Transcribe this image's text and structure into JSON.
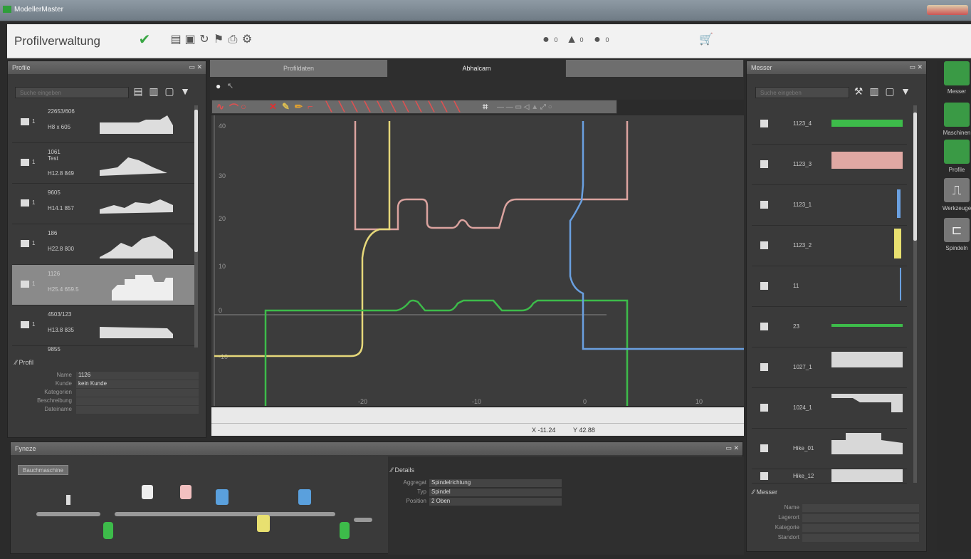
{
  "window": {
    "title": "ModellerMaster"
  },
  "toolbar": {
    "title": "Profilverwaltung",
    "icons": [
      "check-icon",
      "document-icon",
      "save-icon",
      "undo-icon",
      "flag-icon",
      "print-icon",
      "gear-icon"
    ],
    "status": [
      {
        "icon": "info-icon",
        "count": "0"
      },
      {
        "icon": "warning-icon",
        "count": "0"
      },
      {
        "icon": "error-icon",
        "count": "0"
      }
    ],
    "cart_icon": "cart-icon"
  },
  "profile_panel": {
    "title": "Profile",
    "search_placeholder": "Suche eingeben",
    "items": [
      {
        "num": "1",
        "line1": "22653/606",
        "line2": "H8 x 605",
        "selected": false
      },
      {
        "num": "1",
        "line1": "1061\nTest",
        "line2": "H12.8 849",
        "selected": false
      },
      {
        "num": "1",
        "line1": "9605",
        "line2": "H14.1 857",
        "selected": false
      },
      {
        "num": "1",
        "line1": "186",
        "line2": "H22.8 800",
        "selected": false
      },
      {
        "num": "1",
        "line1": "1126",
        "line2": "H25.4 659.5",
        "selected": true
      },
      {
        "num": "1",
        "line1": "4503/123",
        "line2": "H13.8 835",
        "selected": false
      }
    ],
    "partial_item": "9855",
    "props_title": "Profil",
    "props": [
      {
        "label": "Name",
        "value": "1126"
      },
      {
        "label": "Kunde",
        "value": "kein Kunde"
      },
      {
        "label": "Kategorien",
        "value": ""
      },
      {
        "label": "Beschreibung",
        "value": ""
      },
      {
        "label": "Dateiname",
        "value": ""
      }
    ]
  },
  "center": {
    "tabs": [
      "Profildaten",
      "Abhalcam",
      ""
    ],
    "active_tab": 1,
    "x_ticks": [
      "-20",
      "-10",
      "0",
      "10"
    ],
    "y_ticks": [
      "40",
      "30",
      "20",
      "10",
      "0",
      "-10"
    ],
    "coords": {
      "x": "X -11.24",
      "y": "Y 42.88"
    }
  },
  "messer_panel": {
    "title": "Messer",
    "search_placeholder": "Suche eingeben",
    "items": [
      {
        "name": "1123_4",
        "color": "#3dbb4a"
      },
      {
        "name": "1123_3",
        "color": "#e0a8a3"
      },
      {
        "name": "1123_1",
        "color": "#6aa0e0"
      },
      {
        "name": "1123_2",
        "color": "#e8e070"
      },
      {
        "name": "11",
        "color": "#6aa0e0"
      },
      {
        "name": "23",
        "color": "#3dbb4a"
      },
      {
        "name": "1027_1",
        "color": "#d8d8d8"
      },
      {
        "name": "1024_1",
        "color": "#d8d8d8"
      },
      {
        "name": "Hike_01",
        "color": "#d8d8d8"
      },
      {
        "name": "Hike_12",
        "color": "#d8d8d8"
      }
    ],
    "props_title": "Messer",
    "props": [
      "Name",
      "Lagerort",
      "Kategorie",
      "Standort"
    ]
  },
  "side_buttons": [
    {
      "label": "Messer",
      "icon": "knife-icon",
      "color": "#3a9a45"
    },
    {
      "label": "Maschinen",
      "icon": "machine-icon",
      "color": "#3a9a45"
    },
    {
      "label": "Profile",
      "icon": "profile-icon",
      "color": "#3a9a45"
    },
    {
      "label": "Werkzeuge",
      "icon": "tool-icon",
      "color": "#777777"
    },
    {
      "label": "Spindeln",
      "icon": "spindle-icon",
      "color": "#777777"
    }
  ],
  "bottom_panel": {
    "title": "Fyneze",
    "button": "Bauchmaschine",
    "details_title": "Details",
    "details": [
      {
        "label": "Aggregat",
        "value": "Spindelrichtung"
      },
      {
        "label": "Typ",
        "value": "Spindel"
      },
      {
        "label": "Position",
        "value": "2 Oben"
      }
    ]
  },
  "colors": {
    "pink": "#dba39f",
    "yellow": "#e6d87a",
    "green": "#3dbb4a",
    "blue": "#6aa0e0",
    "brand_green": "#2f9e3a"
  }
}
